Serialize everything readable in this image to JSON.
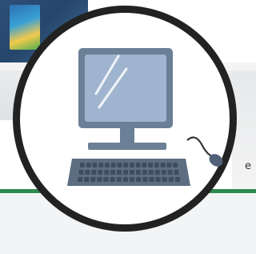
{
  "background": {
    "fragment_text": "e",
    "colors": {
      "frame": "#222222",
      "monitor_body": "#6b7f96",
      "screen": "#9fb4cf",
      "keyboard": "#5d6d82",
      "accent_green": "#2e8a4e"
    }
  },
  "icon": {
    "name": "desktop-computer-icon"
  }
}
